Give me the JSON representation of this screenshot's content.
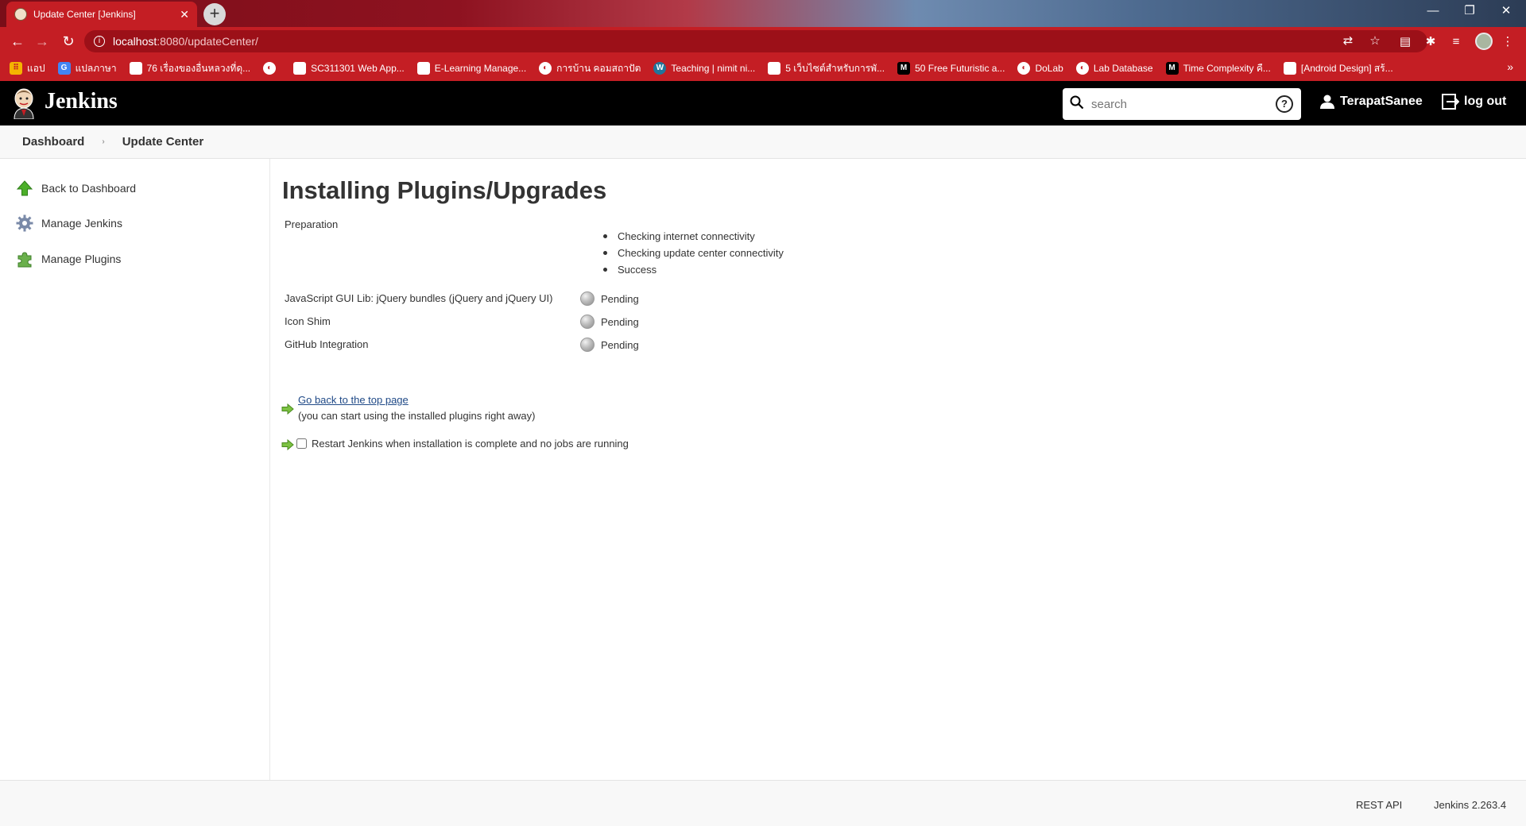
{
  "browser": {
    "tab_title": "Update Center [Jenkins]",
    "url_host": "localhost",
    "url_path": ":8080/updateCenter/",
    "bookmarks": [
      {
        "label": "แอป",
        "icon": "apps-grid-icon"
      },
      {
        "label": "แปลภาษา",
        "icon": "translate-icon"
      },
      {
        "label": "76 เรื่องของอื่นหลวงที่ดุ...",
        "icon": "site-icon"
      },
      {
        "label": "",
        "icon": "globe-icon"
      },
      {
        "label": "SC311301 Web App...",
        "icon": "site-icon"
      },
      {
        "label": "E-Learning Manage...",
        "icon": "site-icon"
      },
      {
        "label": "การบ้าน คอมสถาปัต",
        "icon": "globe-icon"
      },
      {
        "label": "Teaching | nimit ni...",
        "icon": "wordpress-icon"
      },
      {
        "label": "5 เว็บไซต์สำหรับการพั...",
        "icon": "site-icon"
      },
      {
        "label": "50 Free Futuristic a...",
        "icon": "medium-icon"
      },
      {
        "label": "DoLab",
        "icon": "globe-icon"
      },
      {
        "label": "Lab Database",
        "icon": "globe-icon"
      },
      {
        "label": "Time Complexity คื...",
        "icon": "medium-icon"
      },
      {
        "label": "[Android Design] สร้...",
        "icon": "site-icon"
      }
    ]
  },
  "header": {
    "app_name": "Jenkins",
    "search_placeholder": "search",
    "username": "TerapatSanee",
    "logout_label": "log out"
  },
  "breadcrumb": {
    "items": [
      "Dashboard",
      "Update Center"
    ]
  },
  "sidebar": {
    "items": [
      {
        "label": "Back to Dashboard",
        "icon": "up-arrow-icon"
      },
      {
        "label": "Manage Jenkins",
        "icon": "gear-icon"
      },
      {
        "label": "Manage Plugins",
        "icon": "puzzle-icon"
      }
    ]
  },
  "main": {
    "title": "Installing Plugins/Upgrades",
    "preparation_label": "Preparation",
    "preparation_steps": [
      "Checking internet connectivity",
      "Checking update center connectivity",
      "Success"
    ],
    "plugins": [
      {
        "name": "JavaScript GUI Lib: jQuery bundles (jQuery and jQuery UI)",
        "status": "Pending"
      },
      {
        "name": "Icon Shim",
        "status": "Pending"
      },
      {
        "name": "GitHub Integration",
        "status": "Pending"
      }
    ],
    "top_link": "Go back to the top page",
    "top_link_sub": "(you can start using the installed plugins right away)",
    "restart_label": "Restart Jenkins when installation is complete and no jobs are running"
  },
  "footer": {
    "rest_api": "REST API",
    "version": "Jenkins 2.263.4"
  },
  "colors": {
    "browser_accent": "#c41e24",
    "jenkins_header": "#000000",
    "link": "#204a87"
  }
}
